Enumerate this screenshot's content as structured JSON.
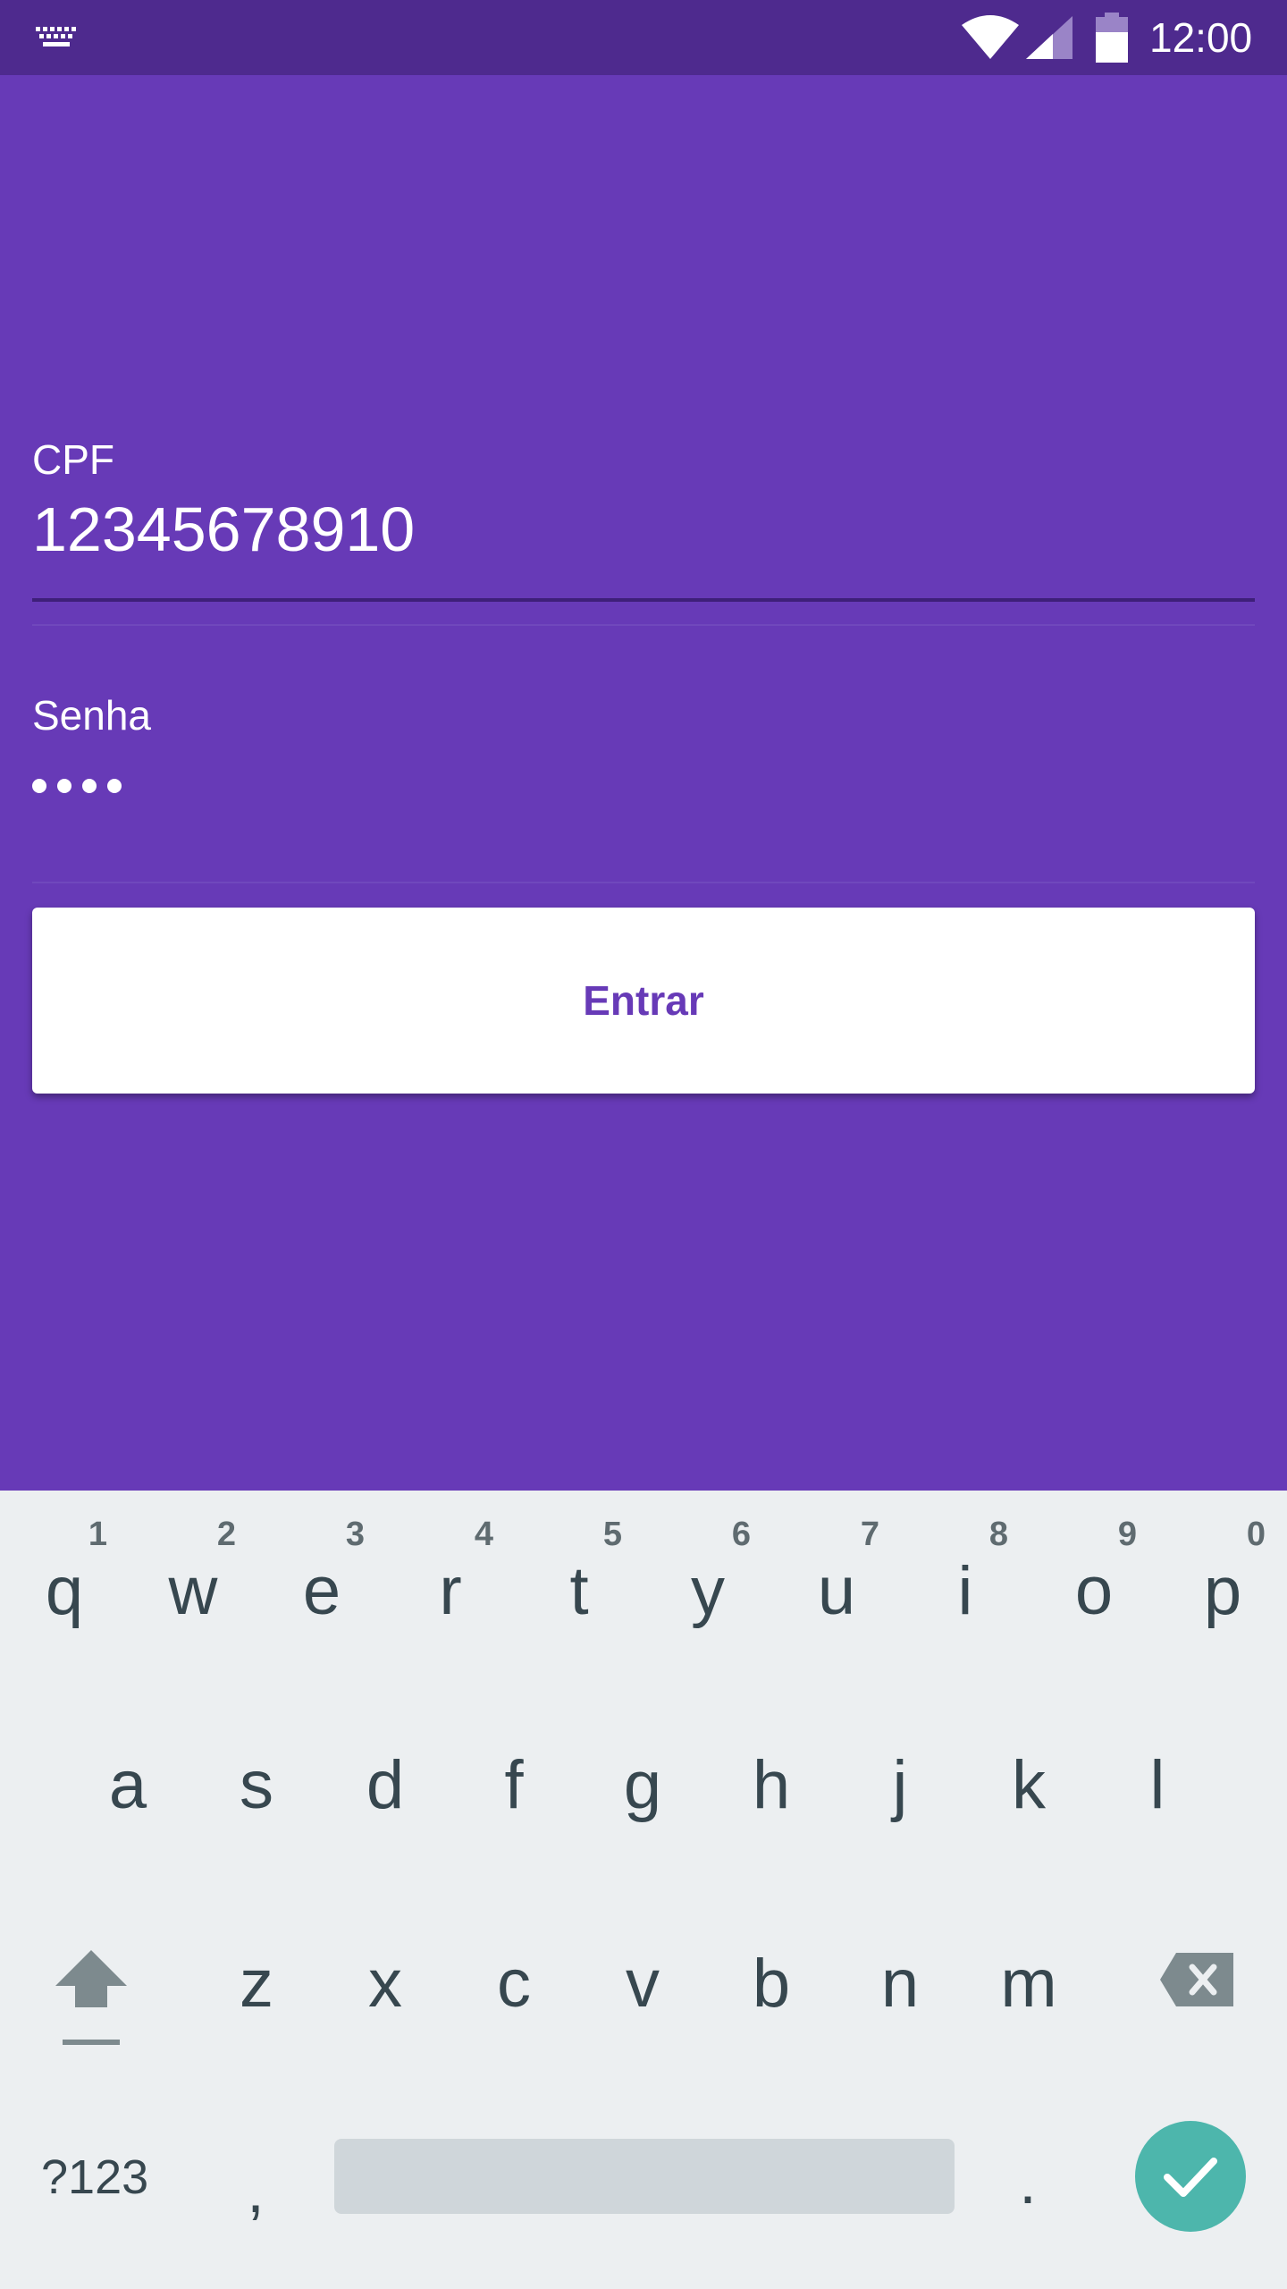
{
  "status_bar": {
    "time": "12:00",
    "icons": [
      "keyboard-icon",
      "wifi-icon",
      "signal-icon",
      "battery-icon"
    ]
  },
  "form": {
    "cpf_label": "CPF",
    "cpf_value": "12345678910",
    "password_label": "Senha",
    "password_length": 4,
    "submit_label": "Entrar"
  },
  "keyboard": {
    "row1": [
      {
        "key": "q",
        "hint": "1"
      },
      {
        "key": "w",
        "hint": "2"
      },
      {
        "key": "e",
        "hint": "3"
      },
      {
        "key": "r",
        "hint": "4"
      },
      {
        "key": "t",
        "hint": "5"
      },
      {
        "key": "y",
        "hint": "6"
      },
      {
        "key": "u",
        "hint": "7"
      },
      {
        "key": "i",
        "hint": "8"
      },
      {
        "key": "o",
        "hint": "9"
      },
      {
        "key": "p",
        "hint": "0"
      }
    ],
    "row2": [
      "a",
      "s",
      "d",
      "f",
      "g",
      "h",
      "j",
      "k",
      "l"
    ],
    "row3": [
      "z",
      "x",
      "c",
      "v",
      "b",
      "n",
      "m"
    ],
    "symbols_label": "?123",
    "comma": ",",
    "period": "."
  },
  "colors": {
    "primary": "#673AB7",
    "status_bar": "#4E2A8E",
    "keyboard_bg": "#ECEFF1",
    "enter_accent": "#4DB6AC"
  }
}
